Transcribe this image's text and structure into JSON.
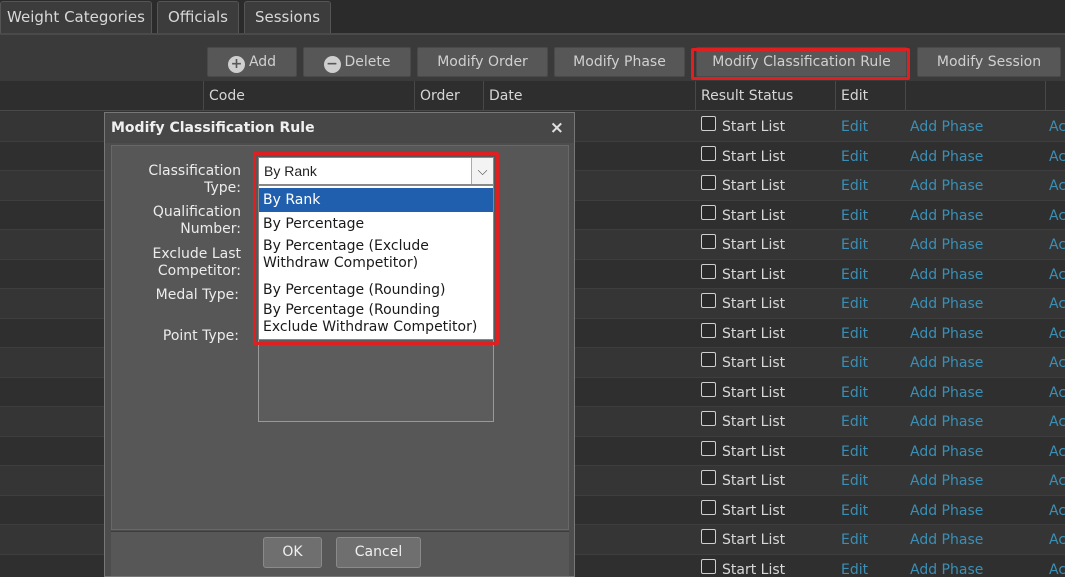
{
  "tabs": [
    "Weight Categories",
    "Officials",
    "Sessions"
  ],
  "toolbar": {
    "add": "Add",
    "delete": "Delete",
    "modify_order": "Modify Order",
    "modify_phase": "Modify Phase",
    "modify_classification_rule": "Modify Classification Rule",
    "modify_session": "Modify Session",
    "add_icon": "plus-circle-icon",
    "delete_icon": "minus-circle-icon"
  },
  "grid": {
    "columns": [
      "Code",
      "Order",
      "Date",
      "Result Status",
      "Edit"
    ],
    "row_status": "Start List",
    "row_edit": "Edit",
    "row_add_phase": "Add Phase",
    "row_add_cut": "Ac",
    "row_count": 16
  },
  "modal": {
    "title": "Modify Classification Rule",
    "close": "×",
    "labels": {
      "classification_type_1": "Classification",
      "classification_type_2": "Type:",
      "qualification_number_1": "Qualification",
      "qualification_number_2": "Number:",
      "exclude_last_1": "Exclude Last",
      "exclude_last_2": "Competitor:",
      "medal_type": "Medal Type:",
      "point_type": "Point Type:"
    },
    "select_value": "By Rank",
    "options": [
      {
        "line1": "By Rank",
        "line2": ""
      },
      {
        "line1": "By Percentage",
        "line2": ""
      },
      {
        "line1": "By Percentage (Exclude",
        "line2": "Withdraw Competitor)"
      },
      {
        "line1": "By Percentage (Rounding)",
        "line2": ""
      },
      {
        "line1": "By Percentage (Rounding",
        "line2": "Exclude Withdraw Competitor)"
      }
    ],
    "ok": "OK",
    "cancel": "Cancel"
  },
  "colors": {
    "highlight": "#e02020",
    "link": "#3b8fb5",
    "selected_option": "#1f5fae"
  }
}
